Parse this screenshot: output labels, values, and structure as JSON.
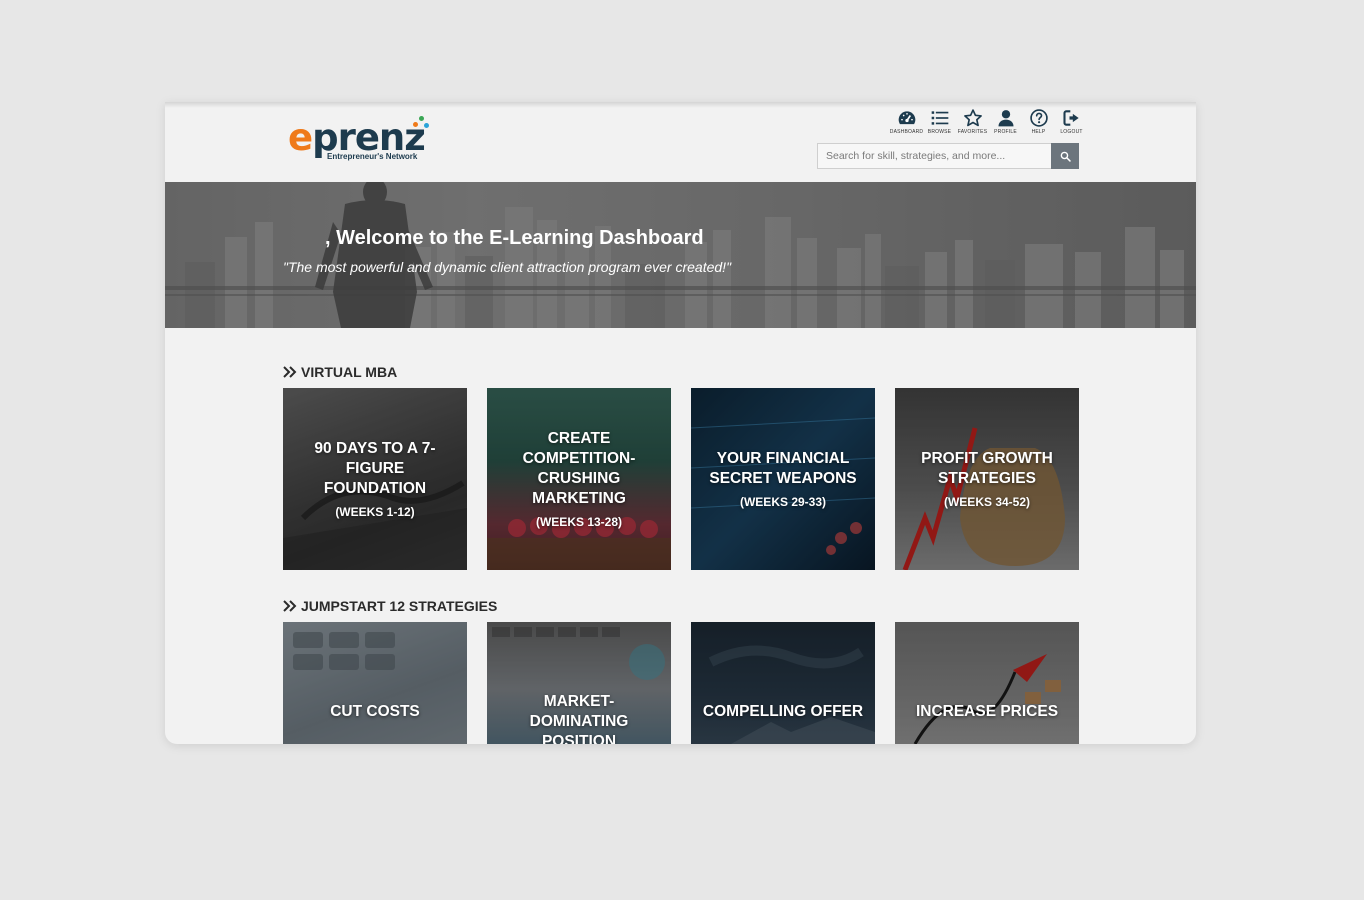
{
  "brand": {
    "logo_e": "e",
    "logo_rest": "prenz",
    "tagline": "Entrepreneur's Network",
    "colors": {
      "orange": "#ef7a1a",
      "navy": "#1d3b4e",
      "dot_orange": "#ef7a1a",
      "dot_green": "#3aa655",
      "dot_blue": "#2aa3d8"
    }
  },
  "nav": {
    "items": [
      {
        "label": "DASHBOARD",
        "icon": "dashboard-gauge-icon"
      },
      {
        "label": "BROWSE",
        "icon": "list-icon"
      },
      {
        "label": "FAVORITES",
        "icon": "star-icon"
      },
      {
        "label": "PROFILE",
        "icon": "user-icon"
      },
      {
        "label": "HELP",
        "icon": "question-circle-icon"
      },
      {
        "label": "LOGOUT",
        "icon": "logout-icon"
      }
    ]
  },
  "search": {
    "placeholder": "Search for skill, strategies, and more...",
    "value": "",
    "button_icon": "search-icon"
  },
  "hero": {
    "title": ", Welcome to the E-Learning Dashboard",
    "subtitle": "\"The most powerful and dynamic client attraction program ever created!\""
  },
  "sections": [
    {
      "heading": "VIRTUAL MBA",
      "cards": [
        {
          "title": "90 DAYS TO A 7-FIGURE FOUNDATION",
          "sub": "(WEEKS 1-12)"
        },
        {
          "title": "CREATE COMPETITION-CRUSHING MARKETING",
          "sub": "(WEEKS 13-28)"
        },
        {
          "title": "YOUR FINANCIAL SECRET WEAPONS",
          "sub": "(WEEKS 29-33)"
        },
        {
          "title": "PROFIT GROWTH STRATEGIES",
          "sub": "(WEEKS 34-52)"
        }
      ]
    },
    {
      "heading": "JUMPSTART 12 STRATEGIES",
      "cards": [
        {
          "title": "CUT COSTS"
        },
        {
          "title": "MARKET-DOMINATING POSITION"
        },
        {
          "title": "COMPELLING OFFER"
        },
        {
          "title": "INCREASE PRICES"
        }
      ]
    }
  ]
}
